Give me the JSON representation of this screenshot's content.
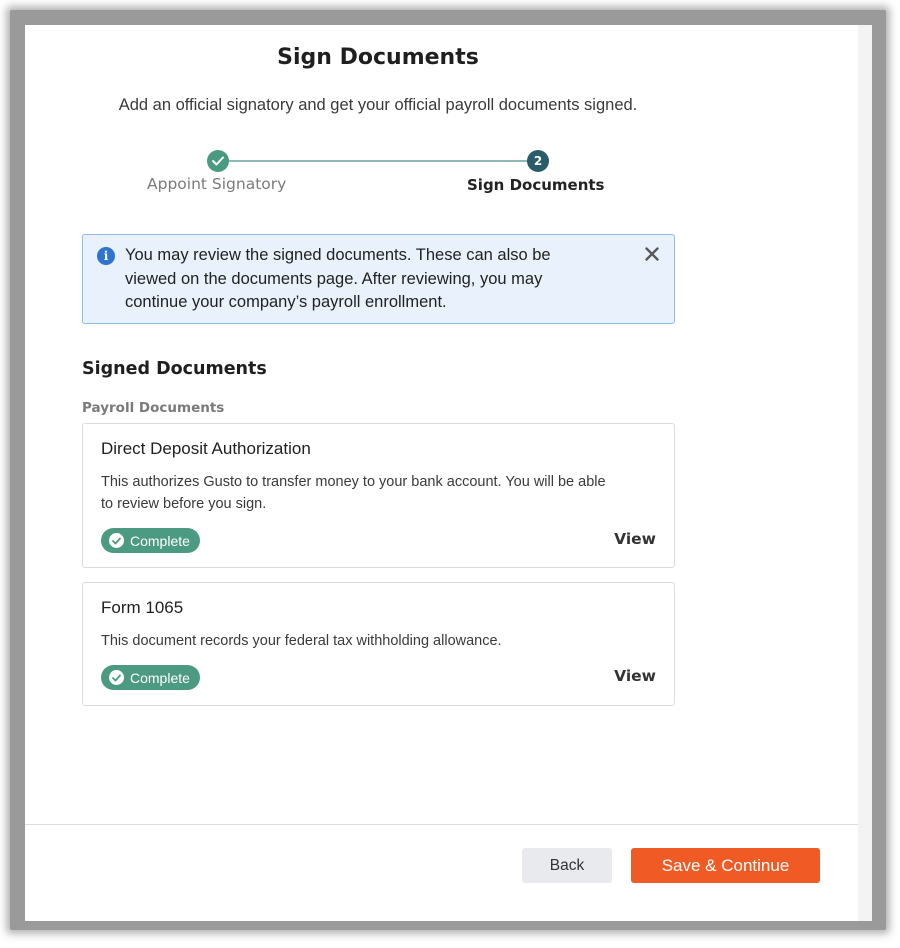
{
  "header": {
    "title": "Sign Documents",
    "subtitle": "Add an official signatory and get your official payroll documents signed."
  },
  "stepper": {
    "steps": [
      {
        "label": "Appoint Signatory",
        "state": "complete"
      },
      {
        "label": "Sign Documents",
        "state": "current",
        "number": "2"
      }
    ]
  },
  "alert": {
    "icon": "info-icon",
    "text": "You may review the signed documents. These can also be viewed on the documents page. After reviewing, you may continue your company’s payroll enrollment.",
    "close_icon": "close-icon"
  },
  "section": {
    "title": "Signed Documents",
    "group_label": "Payroll Documents"
  },
  "documents": [
    {
      "title": "Direct Deposit Authorization",
      "description": "This authorizes Gusto to transfer money to your bank account. You will be able to review before you sign.",
      "status": "Complete",
      "action": "View"
    },
    {
      "title": "Form 1065",
      "description": "This document records your federal tax withholding allowance.",
      "status": "Complete",
      "action": "View"
    }
  ],
  "footer": {
    "back_label": "Back",
    "continue_label": "Save & Continue"
  },
  "colors": {
    "accent": "#f05a24",
    "success": "#4d9a82",
    "step_current": "#2a5c6b",
    "info": "#2f74d0",
    "info_bg": "#e8f1fc"
  }
}
